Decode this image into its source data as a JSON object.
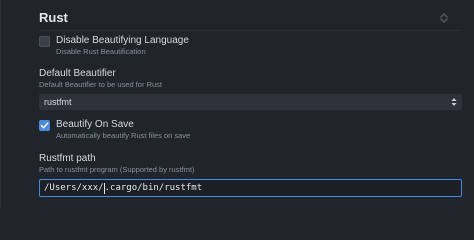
{
  "section": {
    "title": "Rust"
  },
  "settings": {
    "disable_beautifying": {
      "label": "Disable Beautifying Language",
      "description": "Disable Rust Beautification",
      "checked": false
    },
    "default_beautifier": {
      "label": "Default Beautifier",
      "description": "Default Beautifier to be used for Rust",
      "value": "rustfmt"
    },
    "beautify_on_save": {
      "label": "Beautify On Save",
      "description": "Automatically beautify Rust files on save",
      "checked": true
    },
    "rustfmt_path": {
      "label": "Rustfmt path",
      "description": "Path to rustfmt program (Supported by rustfmt)",
      "value_before_caret": "/Users/xxx/",
      "value_after_caret": ".cargo/bin/rustfmt"
    }
  },
  "colors": {
    "background": "#20242b",
    "accent": "#4a89dc",
    "muted_text": "#8b929c"
  },
  "icons": {
    "collapse": "collapse-icon",
    "check": "checkmark-icon",
    "select": "select-arrows-icon"
  }
}
